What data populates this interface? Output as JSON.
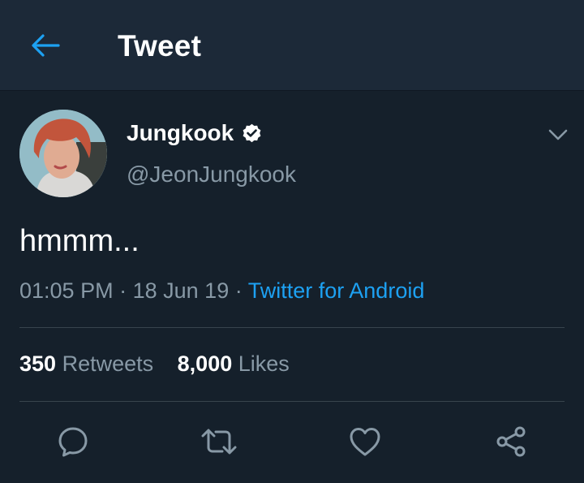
{
  "header": {
    "title": "Tweet",
    "back_icon": "arrow-left-icon"
  },
  "tweet": {
    "author_name": "Jungkook",
    "author_handle": "@JeonJungkook",
    "verified": true,
    "text": "hmmm...",
    "time": "01:05 PM",
    "date": "18 Jun 19",
    "separator": "·",
    "source": "Twitter for Android"
  },
  "stats": {
    "retweets_count": "350",
    "retweets_label": "Retweets",
    "likes_count": "8,000",
    "likes_label": "Likes"
  },
  "actions": [
    "reply-icon",
    "retweet-icon",
    "like-icon",
    "share-icon"
  ],
  "colors": {
    "background": "#15202b",
    "header_background": "#1c2938",
    "accent": "#1da1f2",
    "secondary_text": "#8899a6",
    "divider": "#38444d"
  }
}
